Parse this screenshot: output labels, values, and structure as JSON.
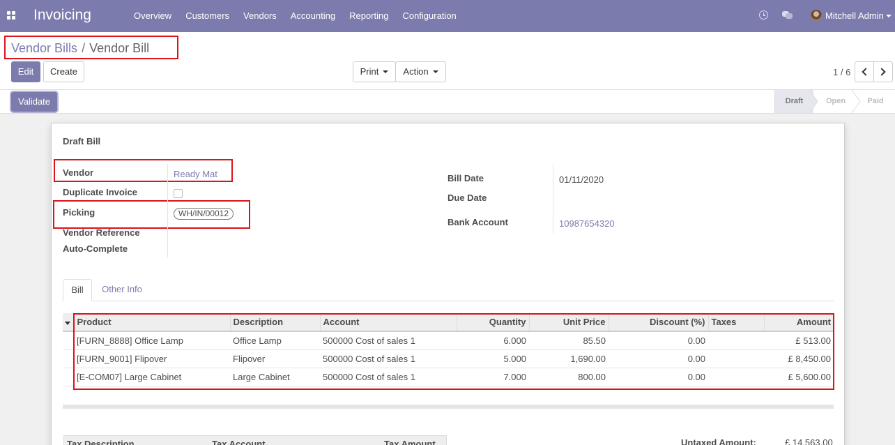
{
  "navbar": {
    "brand": "Invoicing",
    "menu": [
      "Overview",
      "Customers",
      "Vendors",
      "Accounting",
      "Reporting",
      "Configuration"
    ],
    "user": "Mitchell Admin",
    "icons": [
      "apps-grid-icon",
      "clock-icon",
      "chat-icon",
      "avatar"
    ]
  },
  "breadcrumb": {
    "parent": "Vendor Bills",
    "separator": "/",
    "current": "Vendor Bill"
  },
  "buttons": {
    "edit": "Edit",
    "create": "Create",
    "print": "Print",
    "action": "Action",
    "validate": "Validate"
  },
  "pager": {
    "value": "1 / 6"
  },
  "status": {
    "stages": [
      "Draft",
      "Open",
      "Paid"
    ],
    "active": "Draft"
  },
  "form": {
    "title": "Draft Bill",
    "vendor_label": "Vendor",
    "vendor_value": "Ready Mat",
    "duplicate_label": "Duplicate Invoice",
    "picking_label": "Picking",
    "picking_value": "WH/IN/00012",
    "vendor_ref_label": "Vendor Reference",
    "autocomplete_label": "Auto-Complete",
    "bill_date_label": "Bill Date",
    "bill_date_value": "01/11/2020",
    "due_date_label": "Due Date",
    "bank_label": "Bank Account",
    "bank_value": "10987654320"
  },
  "tabs": [
    "Bill",
    "Other Info"
  ],
  "lines": {
    "headers": [
      "Product",
      "Description",
      "Account",
      "Quantity",
      "Unit Price",
      "Discount (%)",
      "Taxes",
      "Amount"
    ],
    "rows": [
      [
        "[FURN_8888] Office Lamp",
        "Office Lamp",
        "500000 Cost of sales 1",
        "6.000",
        "85.50",
        "0.00",
        "",
        "£ 513.00"
      ],
      [
        "[FURN_9001] Flipover",
        "Flipover",
        "500000 Cost of sales 1",
        "5.000",
        "1,690.00",
        "0.00",
        "",
        "£ 8,450.00"
      ],
      [
        "[E-COM07] Large Cabinet",
        "Large Cabinet",
        "500000 Cost of sales 1",
        "7.000",
        "800.00",
        "0.00",
        "",
        "£ 5,600.00"
      ]
    ]
  },
  "tax": {
    "headers": [
      "Tax Description",
      "Tax Account",
      "Tax Amount"
    ],
    "untaxed_label": "Untaxed Amount:",
    "untaxed_value": "£ 14,563.00"
  }
}
